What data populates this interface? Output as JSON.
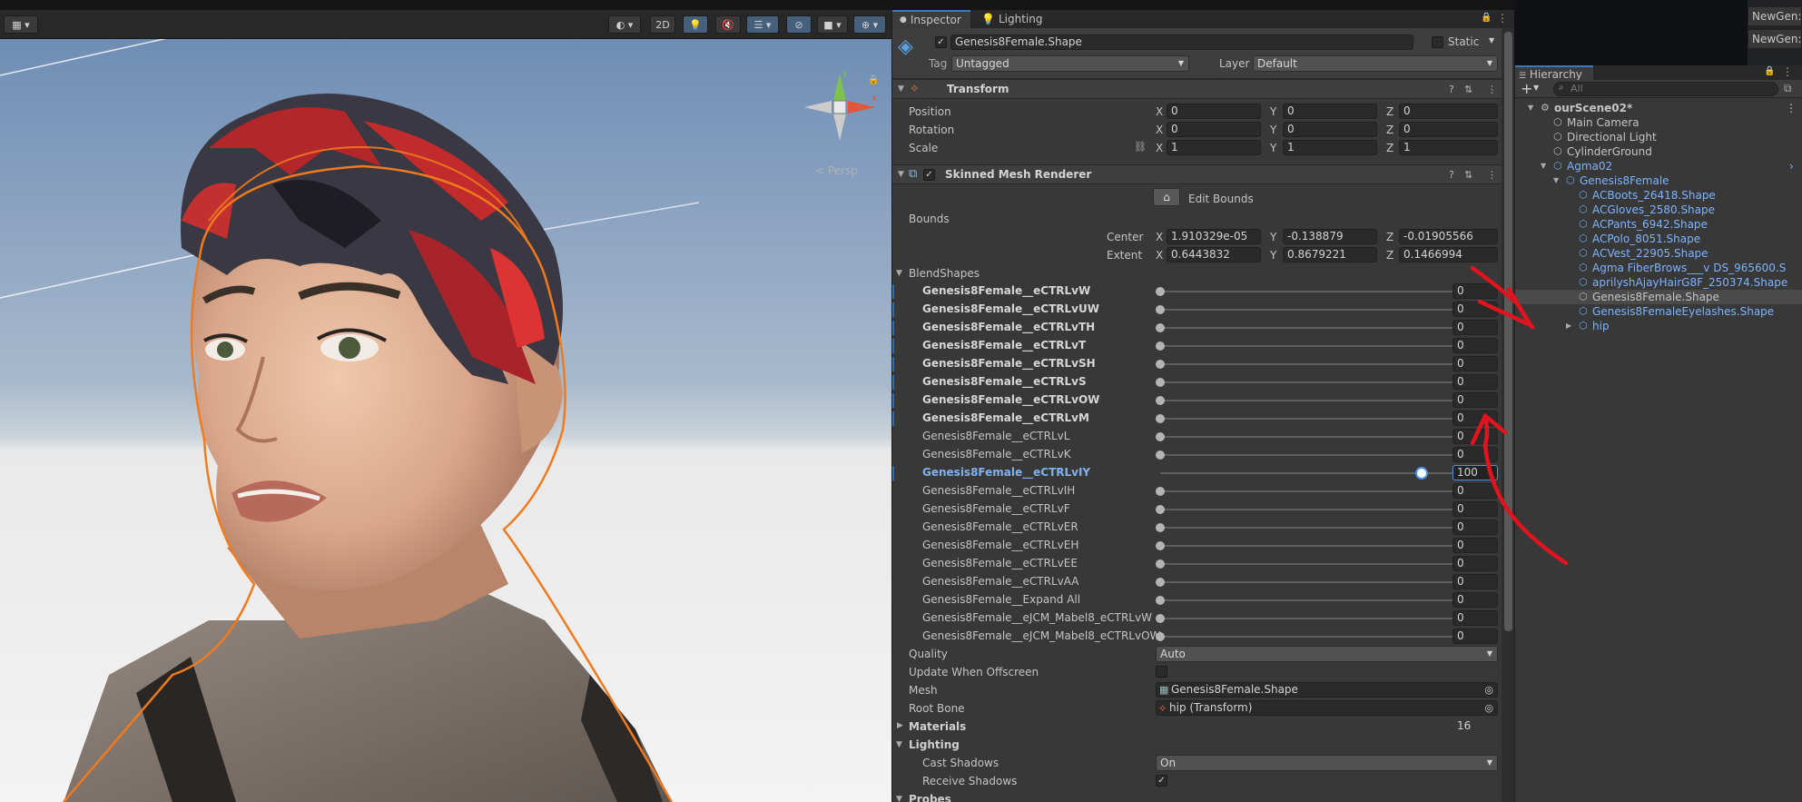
{
  "scene": {
    "toolbar": {
      "mode_2d": "2D"
    },
    "persp_label": "< Persp",
    "gizmo": {
      "x": "x",
      "y": "y"
    }
  },
  "inspector": {
    "tabs": [
      {
        "label": "Inspector"
      },
      {
        "label": "Lighting"
      }
    ],
    "object": {
      "active": "✓",
      "name": "Genesis8Female.Shape",
      "static_label": "Static",
      "tag_label": "Tag",
      "tag_value": "Untagged",
      "layer_label": "Layer",
      "layer_value": "Default"
    },
    "transform": {
      "title": "Transform",
      "rows": [
        {
          "label": "Position",
          "x": "0",
          "y": "0",
          "z": "0"
        },
        {
          "label": "Rotation",
          "x": "0",
          "y": "0",
          "z": "0"
        },
        {
          "label": "Scale",
          "x": "1",
          "y": "1",
          "z": "1"
        }
      ]
    },
    "smr": {
      "title": "Skinned Mesh Renderer",
      "edit_bounds": "Edit Bounds",
      "bounds_label": "Bounds",
      "center_label": "Center",
      "center": {
        "x": "1.910329e-05",
        "y": "-0.138879",
        "z": "-0.01905566"
      },
      "extent_label": "Extent",
      "extent": {
        "x": "0.6443832",
        "y": "0.8679221",
        "z": "0.1466994"
      },
      "blendshapes_label": "BlendShapes",
      "blendshapes": [
        {
          "name": "Genesis8Female__eCTRLvW",
          "value": "0",
          "level": 0,
          "style": "bold"
        },
        {
          "name": "Genesis8Female__eCTRLvUW",
          "value": "0",
          "level": 0,
          "style": "bold"
        },
        {
          "name": "Genesis8Female__eCTRLvTH",
          "value": "0",
          "level": 0,
          "style": "bold"
        },
        {
          "name": "Genesis8Female__eCTRLvT",
          "value": "0",
          "level": 0,
          "style": "bold"
        },
        {
          "name": "Genesis8Female__eCTRLvSH",
          "value": "0",
          "level": 0,
          "style": "bold"
        },
        {
          "name": "Genesis8Female__eCTRLvS",
          "value": "0",
          "level": 0,
          "style": "bold"
        },
        {
          "name": "Genesis8Female__eCTRLvOW",
          "value": "0",
          "level": 0,
          "style": "bold"
        },
        {
          "name": "Genesis8Female__eCTRLvM",
          "value": "0",
          "level": 0,
          "style": "bold"
        },
        {
          "name": "Genesis8Female__eCTRLvL",
          "value": "0",
          "level": 0,
          "style": "normal"
        },
        {
          "name": "Genesis8Female__eCTRLvK",
          "value": "0",
          "level": 0,
          "style": "normal"
        },
        {
          "name": "Genesis8Female__eCTRLvIY",
          "value": "100",
          "level": 1,
          "style": "selected"
        },
        {
          "name": "Genesis8Female__eCTRLvIH",
          "value": "0",
          "level": 0,
          "style": "normal"
        },
        {
          "name": "Genesis8Female__eCTRLvF",
          "value": "0",
          "level": 0,
          "style": "normal"
        },
        {
          "name": "Genesis8Female__eCTRLvER",
          "value": "0",
          "level": 0,
          "style": "normal"
        },
        {
          "name": "Genesis8Female__eCTRLvEH",
          "value": "0",
          "level": 0,
          "style": "normal"
        },
        {
          "name": "Genesis8Female__eCTRLvEE",
          "value": "0",
          "level": 0,
          "style": "normal"
        },
        {
          "name": "Genesis8Female__eCTRLvAA",
          "value": "0",
          "level": 0,
          "style": "normal"
        },
        {
          "name": "Genesis8Female__Expand All",
          "value": "0",
          "level": 0,
          "style": "normal"
        },
        {
          "name": "Genesis8Female__eJCM_Mabel8_eCTRLvW",
          "value": "0",
          "level": 0,
          "style": "normal"
        },
        {
          "name": "Genesis8Female__eJCM_Mabel8_eCTRLvOW",
          "value": "0",
          "level": 0,
          "style": "normal"
        }
      ],
      "quality_label": "Quality",
      "quality_value": "Auto",
      "update_offscreen_label": "Update When Offscreen",
      "mesh_label": "Mesh",
      "mesh_value": "Genesis8Female.Shape",
      "root_bone_label": "Root Bone",
      "root_bone_value": "hip (Transform)",
      "materials_label": "Materials",
      "materials_count": "16",
      "lighting_label": "Lighting",
      "cast_shadows_label": "Cast Shadows",
      "cast_shadows_value": "On",
      "receive_shadows_label": "Receive Shadows",
      "probes_label": "Probes"
    }
  },
  "hierarchy": {
    "title": "Hierarchy",
    "search_placeholder": "All",
    "items": [
      {
        "label": "ourScene02*",
        "depth": 0,
        "kind": "scene"
      },
      {
        "label": "Main Camera",
        "depth": 1,
        "kind": "object"
      },
      {
        "label": "Directional Light",
        "depth": 1,
        "kind": "object"
      },
      {
        "label": "CylinderGround",
        "depth": 1,
        "kind": "object"
      },
      {
        "label": "Agma02",
        "depth": 1,
        "kind": "prefab"
      },
      {
        "label": "Genesis8Female",
        "depth": 2,
        "kind": "prefab"
      },
      {
        "label": "ACBoots_26418.Shape",
        "depth": 3,
        "kind": "prefab"
      },
      {
        "label": "ACGloves_2580.Shape",
        "depth": 3,
        "kind": "prefab"
      },
      {
        "label": "ACPants_6942.Shape",
        "depth": 3,
        "kind": "prefab"
      },
      {
        "label": "ACPolo_8051.Shape",
        "depth": 3,
        "kind": "prefab"
      },
      {
        "label": "ACVest_22905.Shape",
        "depth": 3,
        "kind": "prefab"
      },
      {
        "label": "Agma FiberBrows___v DS_965600.S",
        "depth": 3,
        "kind": "prefab"
      },
      {
        "label": "aprilyshAjayHairG8F_250374.Shape",
        "depth": 3,
        "kind": "prefab"
      },
      {
        "label": "Genesis8Female.Shape",
        "depth": 3,
        "kind": "selected"
      },
      {
        "label": "Genesis8FemaleEyelashes.Shape",
        "depth": 3,
        "kind": "prefab"
      },
      {
        "label": "hip",
        "depth": 3,
        "kind": "prefab"
      }
    ]
  },
  "newgen": {
    "labels": [
      "NewGen:",
      "NewGen:"
    ]
  },
  "colors": {
    "accent": "#3a79bb",
    "selection_blue": "#7cb3ff",
    "annotation_red": "#e0141e"
  }
}
